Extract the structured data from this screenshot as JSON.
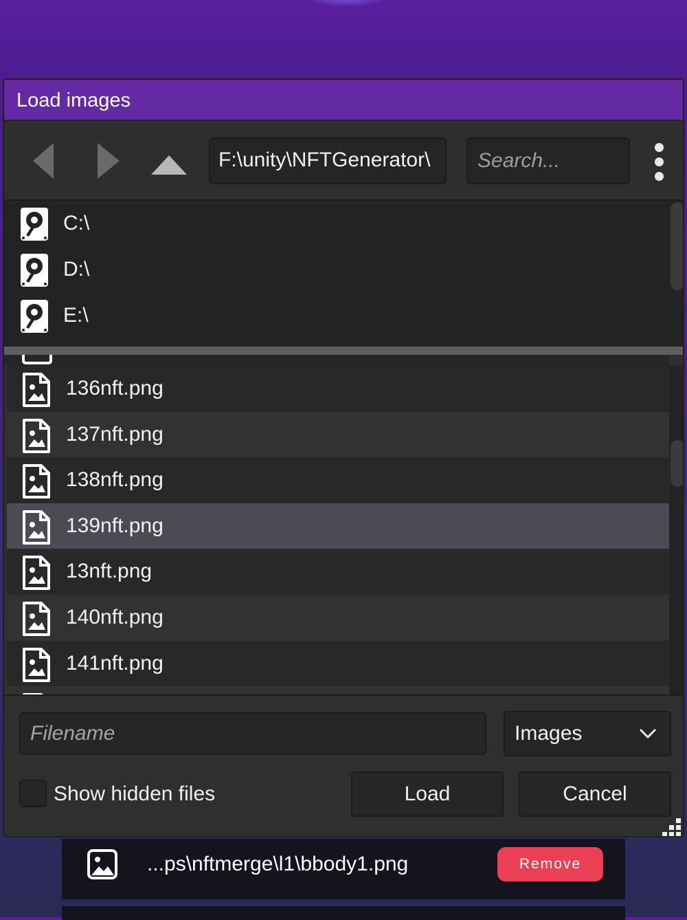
{
  "dialog": {
    "title": "Load images",
    "path": "F:\\unity\\NFTGenerator\\",
    "search_placeholder": "Search...",
    "drives": [
      {
        "label": "C:\\",
        "icon": "hard-drive-icon"
      },
      {
        "label": "D:\\",
        "icon": "hard-drive-icon"
      },
      {
        "label": "E:\\",
        "icon": "hard-drive-icon"
      }
    ],
    "files": [
      {
        "label": "136nft.png",
        "icon": "image-file-icon"
      },
      {
        "label": "137nft.png",
        "icon": "image-file-icon"
      },
      {
        "label": "138nft.png",
        "icon": "image-file-icon"
      },
      {
        "label": "139nft.png",
        "icon": "image-file-icon",
        "selected": true
      },
      {
        "label": "13nft.png",
        "icon": "image-file-icon"
      },
      {
        "label": "140nft.png",
        "icon": "image-file-icon"
      },
      {
        "label": "141nft.png",
        "icon": "image-file-icon"
      }
    ],
    "filename_placeholder": "Filename",
    "filter": "Images",
    "show_hidden_label": "Show hidden files",
    "show_hidden_checked": false,
    "load_label": "Load",
    "cancel_label": "Cancel"
  },
  "background_list": {
    "item_path": "...ps\\nftmerge\\l1\\bbody1.png",
    "remove_label": "Remove"
  },
  "colors": {
    "title_bar": "#6429a3",
    "dialog_bg": "#2f2f2f",
    "selected_row": "#4b4b53",
    "remove_button": "#ea3f55"
  }
}
